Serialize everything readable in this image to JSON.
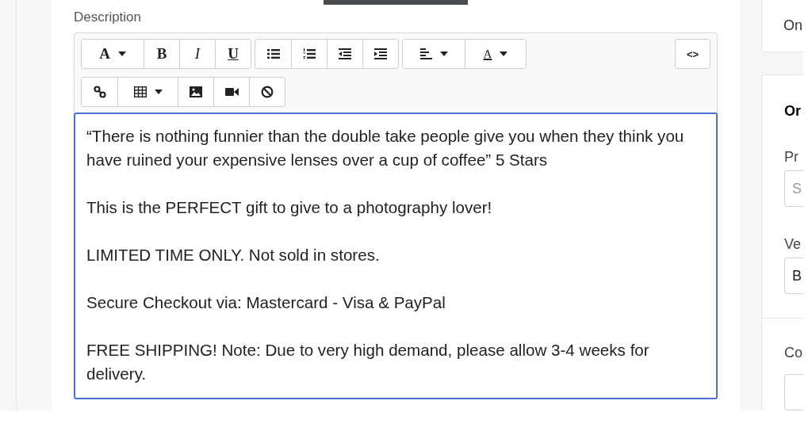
{
  "description": {
    "label": "Description",
    "toolbar": [
      [
        [
          {
            "kind": "font",
            "label": "A",
            "dropdown": true
          },
          {
            "kind": "bold",
            "label": "B",
            "dropdown": false
          },
          {
            "kind": "italic",
            "label": "I",
            "dropdown": false
          },
          {
            "kind": "underline",
            "label": "U",
            "dropdown": false
          }
        ],
        [
          {
            "kind": "bullet-list",
            "dropdown": false
          },
          {
            "kind": "numbered-list",
            "dropdown": false
          },
          {
            "kind": "outdent",
            "dropdown": false
          },
          {
            "kind": "indent",
            "dropdown": false
          }
        ],
        [
          {
            "kind": "align",
            "dropdown": true
          },
          {
            "kind": "color",
            "label": "A",
            "dropdown": true
          }
        ]
      ],
      [
        [
          {
            "kind": "link",
            "dropdown": false
          },
          {
            "kind": "table",
            "dropdown": true
          },
          {
            "kind": "image",
            "dropdown": false
          },
          {
            "kind": "video",
            "dropdown": false
          },
          {
            "kind": "clear",
            "dropdown": false
          }
        ]
      ]
    ],
    "code_button": "<>",
    "paragraphs": [
      "“There is nothing funnier than the double take people give you when they think you have ruined your expensive lenses over a cup of coffee” 5 Stars",
      "This is the PERFECT gift to give to a photography lover!",
      "LIMITED TIME ONLY. Not sold in stores.",
      "Secure Checkout via: Mastercard - Visa & PayPal",
      "FREE SHIPPING! Note: Due to very high demand, please allow 3-4 weeks for delivery."
    ]
  },
  "sidebar": {
    "top_card": {
      "text": "On"
    },
    "card": {
      "heading": "Or",
      "fields": [
        {
          "label": "Pr",
          "placeholder": "S"
        },
        {
          "label": "Ve",
          "value": "B"
        }
      ],
      "section": {
        "label": "Co"
      }
    }
  }
}
